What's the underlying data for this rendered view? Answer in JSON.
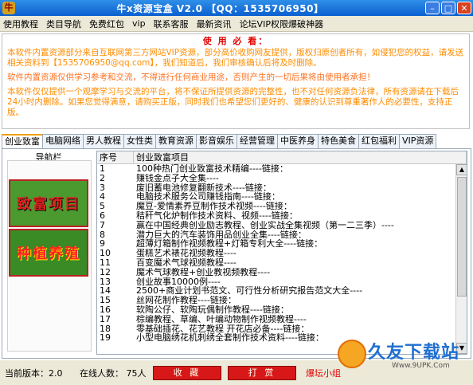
{
  "window": {
    "title": "牛x资源宝盒 V2.0 【QQ：1535706950】",
    "icon_glyph": "牛",
    "controls": [
      "–",
      "□",
      "✕"
    ]
  },
  "menu": [
    "使用教程",
    "类目导航",
    "免费红包",
    "vip",
    "联系客服",
    "最新资讯",
    "论坛VIP权限爆破神器"
  ],
  "notice": {
    "title": "使 用 必 看：",
    "paragraphs": [
      "本软件内置资源部分来自互联网第三方网站VIP资源，部分高价收购网友提供，版权归原创者所有，如侵犯您的权益，请发送相关资料到【1535706950@qq.com】，我们知道后，我们审核确认后将及时删除。",
      "软件内置资源仅供学习参考和交流，不得进行任何商业用途，否则产生的一切后果将由使用者承担！",
      "本软件仅仅提供一个观摩学习与交流的平台，将不保证所提供资源的完整性，也不对任何资源负法律，所有资源请在下载后24小时内删除。如果您觉得满意，请购买正版，同时我们也希望您们更好的、健康的认识到尊重著作人的必要性，支持正版。"
    ]
  },
  "tabs": [
    "创业致富",
    "电脑网络",
    "男人教程",
    "女性类",
    "教育资源",
    "影音娱乐",
    "经营管理",
    "中医养身",
    "特色美食",
    "红包福利",
    "VIP资源"
  ],
  "nav": {
    "label": "导航栏",
    "buttons": [
      "致富项目",
      "种植养殖"
    ]
  },
  "list": {
    "headers": [
      "序号",
      "创业致富项目"
    ],
    "rows": [
      [
        "1",
        "100种热门创业致富技术精编----链接："
      ],
      [
        "2",
        "赚钱金点子大全集----"
      ],
      [
        "3",
        "废旧蓄电池修复翻新技术----链接："
      ],
      [
        "4",
        "电脑技术服务公司赚钱指南----链接："
      ],
      [
        "5",
        "魔豆-爱情素养豆制作技术视频----链接："
      ],
      [
        "6",
        "秸秆气化炉制作技术资料、视频----链接："
      ],
      [
        "7",
        "赢在中国经典创业励志教程、创业实战全集视频（第一二三季）----"
      ],
      [
        "8",
        "潜力巨大的汽车装饰用品创业全集----链接："
      ],
      [
        "9",
        "超薄灯箱制作视频教程+灯箱专利大全----链接："
      ],
      [
        "10",
        "蛋糕艺术裱花视频教程----"
      ],
      [
        "11",
        "百变魔术气球视频教程----"
      ],
      [
        "12",
        "魔术气球教程+创业教视频教程----"
      ],
      [
        "13",
        "创业故事10000例----"
      ],
      [
        "14",
        "2500+商业计划书范文、可行性分析研究报告范文大全----"
      ],
      [
        "15",
        "丝网花制作教程----链接："
      ],
      [
        "16",
        "软陶公仔、软陶玩偶制作教程----链接："
      ],
      [
        "17",
        "棕编教程、草编、叶编动物制作视频教程----"
      ],
      [
        "18",
        "零基础插花、花艺教程 开花店必备----链接："
      ],
      [
        "19",
        "小型电脑绣花机刺绣全套制作技术资料----链接："
      ]
    ]
  },
  "status": {
    "version_label": "当前版本：2.0",
    "online_label": "在线人数： 75人",
    "btn_collect": "收 藏",
    "btn_tip": "打 赏",
    "marquee": "爆坛小组"
  },
  "watermark": {
    "text": "久友下载站",
    "url": "Www.9UPK.Com"
  },
  "colors": {
    "title_blue": "#0a5fd0",
    "notice_orange": "#ff8c00",
    "notice_red": "#e00000",
    "nav_green": "#3f8a2a",
    "button_red": "#d81818"
  }
}
